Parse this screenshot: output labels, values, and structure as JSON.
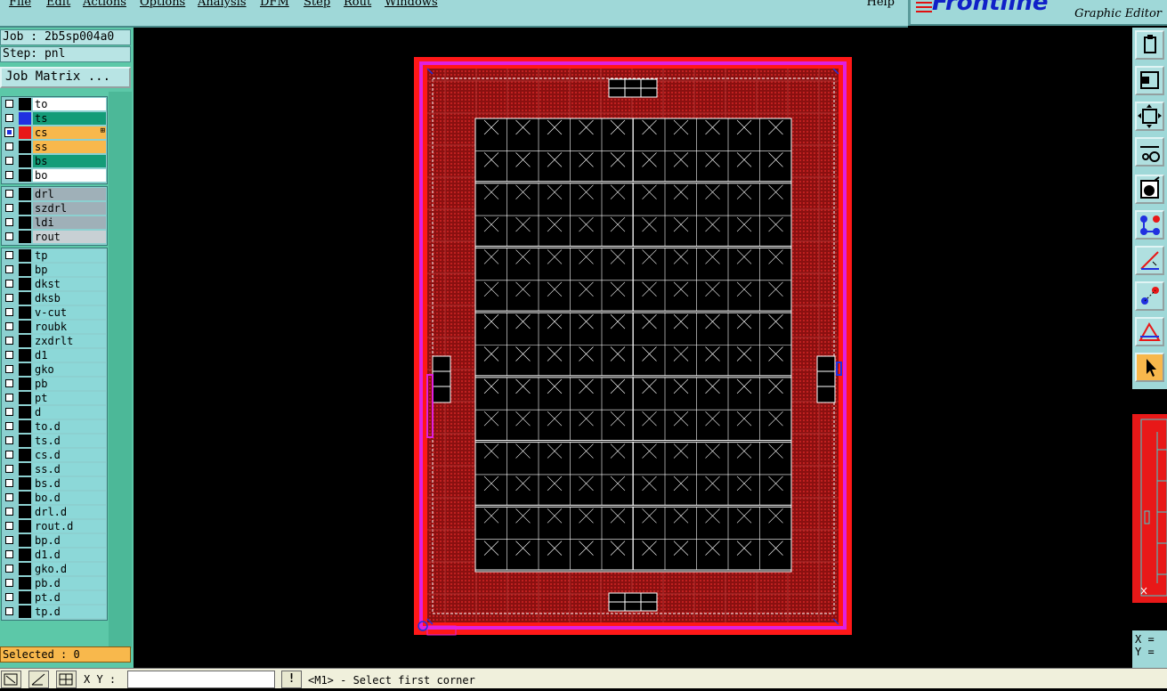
{
  "menu": {
    "items": [
      "File",
      "Edit",
      "Actions",
      "Options",
      "Analysis",
      "DFM",
      "Step",
      "Rout",
      "Windows"
    ],
    "help": "Help"
  },
  "brand": {
    "logo": "Frontline",
    "subtitle": "Graphic Editor"
  },
  "job": {
    "job_label": "Job : 2b5sp004a0",
    "step_label": "Step: pnl",
    "matrix_button": "Job Matrix ..."
  },
  "layers": {
    "board": [
      {
        "name": "to",
        "color": "#ffffff",
        "swatch": "#000000"
      },
      {
        "name": "ts",
        "color": "#149c78",
        "swatch": "#2030e0"
      },
      {
        "name": "cs",
        "color": "#f8b84c",
        "swatch": "#e81818",
        "active": true,
        "indicator": "⊞"
      },
      {
        "name": "ss",
        "color": "#f8b84c",
        "swatch": "#000000"
      },
      {
        "name": "bs",
        "color": "#149c78",
        "swatch": "#000000"
      },
      {
        "name": "bo",
        "color": "#ffffff",
        "swatch": "#000000"
      }
    ],
    "drill": [
      {
        "name": "drl",
        "color": "#9fb0b8"
      },
      {
        "name": "szdrl",
        "color": "#9fb0b8"
      },
      {
        "name": "ldi",
        "color": "#9fb0b8"
      },
      {
        "name": "rout",
        "color": "#c8d0d4"
      }
    ],
    "misc": [
      "tp",
      "bp",
      "dkst",
      "dksb",
      "v-cut",
      "roubk",
      "zxdrlt",
      "d1",
      "gko",
      "pb",
      "pt",
      "d",
      "to.d",
      "ts.d",
      "cs.d",
      "ss.d",
      "bs.d",
      "bo.d",
      "drl.d",
      "rout.d",
      "bp.d",
      "d1.d",
      "gko.d",
      "pb.d",
      "pt.d",
      "tp.d"
    ],
    "misc_color": "#8cd8d8"
  },
  "selected_label": "Selected : 0",
  "toolbar": {
    "icons": [
      "snapshot-icon",
      "fit-page-icon",
      "zoom-fit-icon",
      "measure-icon",
      "feature-box-icon",
      "netlist-icon",
      "angle-icon",
      "attributes-icon",
      "drc-icon",
      "pointer-icon"
    ],
    "selected_index": 9
  },
  "coords": {
    "x_label": "X =",
    "y_label": "Y ="
  },
  "statusbar": {
    "xy_label": "X Y :",
    "xy_value": "",
    "alert": "!",
    "prompt": "<M1> - Select first corner"
  },
  "colors": {
    "panel_red": "#a01818",
    "border_magenta": "#e020e0",
    "outer_red": "#ff1818",
    "grid_white": "#ffffff"
  }
}
